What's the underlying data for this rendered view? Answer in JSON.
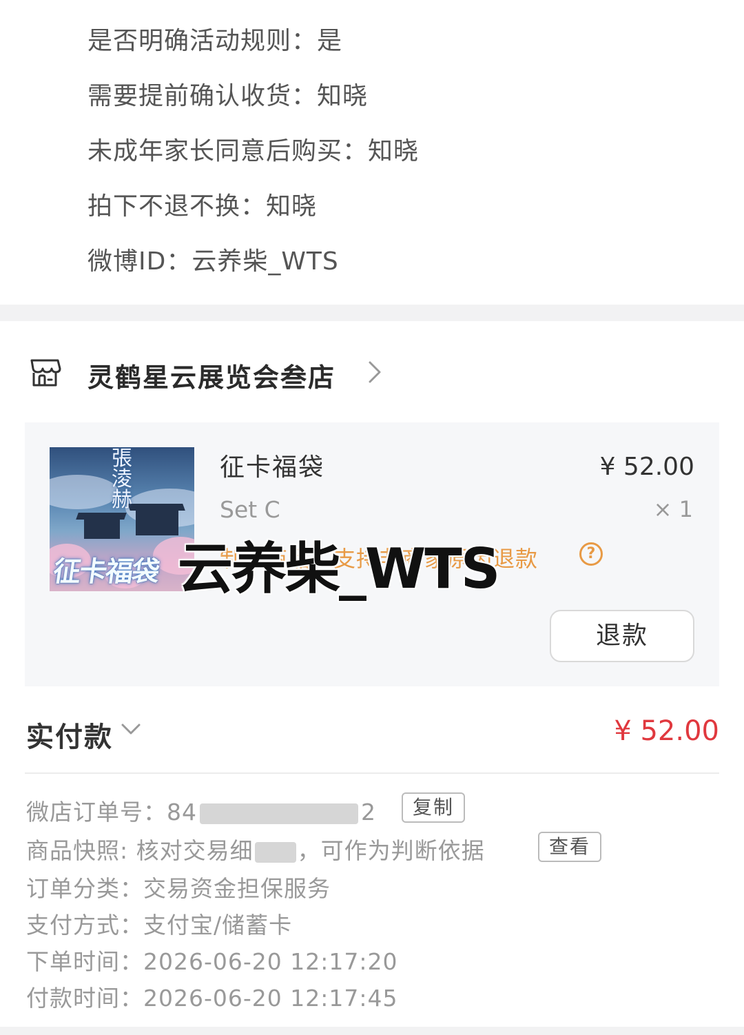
{
  "info_lines": [
    "是否明确活动规则：是",
    "需要提前确认收货：知晓",
    "未成年家长同意后购买：知晓",
    "拍下不退不换：知晓",
    "微博ID：云养柴_WTS"
  ],
  "shop": {
    "name": "灵鹤星云展览会叁店",
    "icon": "storefront-icon"
  },
  "item": {
    "title": "征卡福袋",
    "price": "¥ 52.00",
    "spec": "Set C",
    "quantity": "× 1",
    "notice": "制作商品，支持非商家原因退款",
    "thumbnail_title": "征卡福袋",
    "thumbnail_vertical_text": "張淩赫",
    "watermark": "云养柴_WTS",
    "refund_label": "退款"
  },
  "payment": {
    "paid_label": "实付款",
    "paid_amount": "¥ 52.00"
  },
  "order_details": {
    "order_no_label": "微店订单号：",
    "order_no_value": "84",
    "order_no_tail": "2",
    "copy_label": "复制",
    "snapshot_label": "商品快照:",
    "snapshot_value": "核对交易细",
    "snapshot_tail": "，可作为判断依据",
    "view_label": "查看",
    "category_label": "订单分类：",
    "category_value": "交易资金担保服务",
    "pay_method_label": "支付方式：",
    "pay_method_value": "支付宝/储蓄卡",
    "order_time_label": "下单时间：",
    "order_time_value": "2026-06-20 12:17:20",
    "pay_time_label": "付款时间：",
    "pay_time_value": "2026-06-20 12:17:45"
  },
  "colors": {
    "price_red": "#e0383e",
    "notice_orange": "#e89a45",
    "card_bg": "#f6f7f9"
  }
}
